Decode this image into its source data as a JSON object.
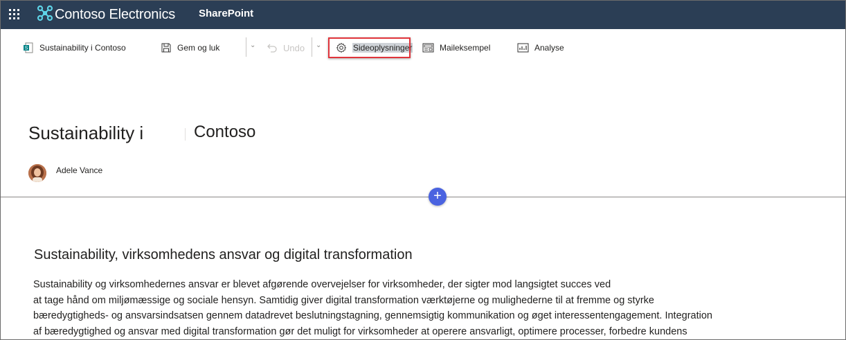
{
  "suitebar": {
    "brand": "Contoso Electronics",
    "product": "SharePoint",
    "background": "#2b3e55"
  },
  "commandbar": {
    "page_name": "Sustainability i Contoso",
    "save_close": "Gem og luk",
    "undo": "Undo",
    "page_details": "Sideoplysninger",
    "email_preview": "Maileksempel",
    "analytics": "Analyse",
    "highlight_color": "#e0343b"
  },
  "page": {
    "title_part1": "Sustainability i",
    "title_part2": "Contoso",
    "author": "Adele Vance",
    "add_section_symbol": "+",
    "accent": "#4a63e0"
  },
  "content": {
    "heading": "Sustainability, virksomhedens ansvar og digital transformation",
    "lines": [
      "Sustainability og virksomhedernes ansvar er blevet afgørende overvejelser for virksomheder, der sigter mod langsigtet succes ved",
      "at tage hånd om miljømæssige og sociale hensyn. Samtidig giver digital transformation værktøjerne og mulighederne til at fremme og styrke",
      "bæredygtigheds- og ansvarsindsatsen gennem datadrevet beslutningstagning, gennemsigtig kommunikation og øget interessentengagement. Integration",
      "af bæredygtighed og ansvar med digital transformation gør det muligt for virksomheder at operere ansvarligt, optimere processer, forbedre kundens"
    ]
  }
}
